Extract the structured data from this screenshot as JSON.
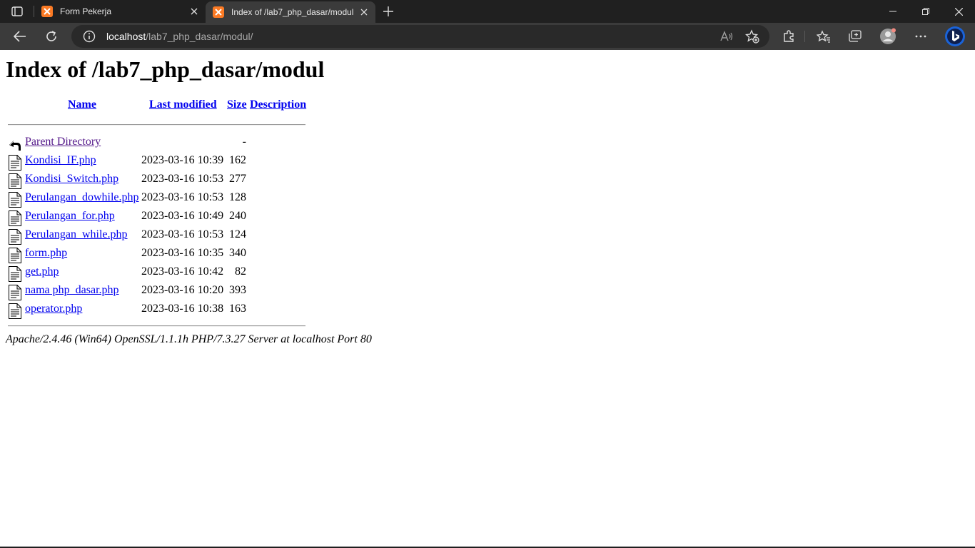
{
  "browser": {
    "tabs": [
      {
        "title": "Form Pekerja",
        "active": false
      },
      {
        "title": "Index of /lab7_php_dasar/modul",
        "active": true
      }
    ],
    "address_bar": {
      "host": "localhost",
      "path": "/lab7_php_dasar/modul/"
    },
    "toolbar_icons": [
      "back-icon",
      "refresh-icon",
      "site-info-icon",
      "read-aloud-icon",
      "add-favorite-icon",
      "extensions-icon",
      "favorites-icon",
      "collections-icon",
      "profile-icon",
      "more-icon",
      "bing-copilot-icon"
    ],
    "window_controls": [
      "minimize-icon",
      "restore-icon",
      "close-icon"
    ]
  },
  "page": {
    "heading": "Index of /lab7_php_dasar/modul",
    "columns": {
      "name": "Name",
      "last_modified": "Last modified",
      "size": "Size",
      "description": "Description"
    },
    "parent": {
      "name": "Parent Directory",
      "size": "-"
    },
    "files": [
      {
        "name": "Kondisi_IF.php",
        "modified": "2023-03-16 10:39",
        "size": "162"
      },
      {
        "name": "Kondisi_Switch.php",
        "modified": "2023-03-16 10:53",
        "size": "277"
      },
      {
        "name": "Perulangan_dowhile.php",
        "modified": "2023-03-16 10:53",
        "size": "128"
      },
      {
        "name": "Perulangan_for.php",
        "modified": "2023-03-16 10:49",
        "size": "240"
      },
      {
        "name": "Perulangan_while.php",
        "modified": "2023-03-16 10:53",
        "size": "124"
      },
      {
        "name": "form.php",
        "modified": "2023-03-16 10:35",
        "size": "340"
      },
      {
        "name": "get.php",
        "modified": "2023-03-16 10:42",
        "size": "82"
      },
      {
        "name": "nama php_dasar.php",
        "modified": "2023-03-16 10:20",
        "size": "393"
      },
      {
        "name": "operator.php",
        "modified": "2023-03-16 10:38",
        "size": "163"
      }
    ],
    "server_signature": "Apache/2.4.46 (Win64) OpenSSL/1.1.1h PHP/7.3.27 Server at localhost Port 80"
  }
}
